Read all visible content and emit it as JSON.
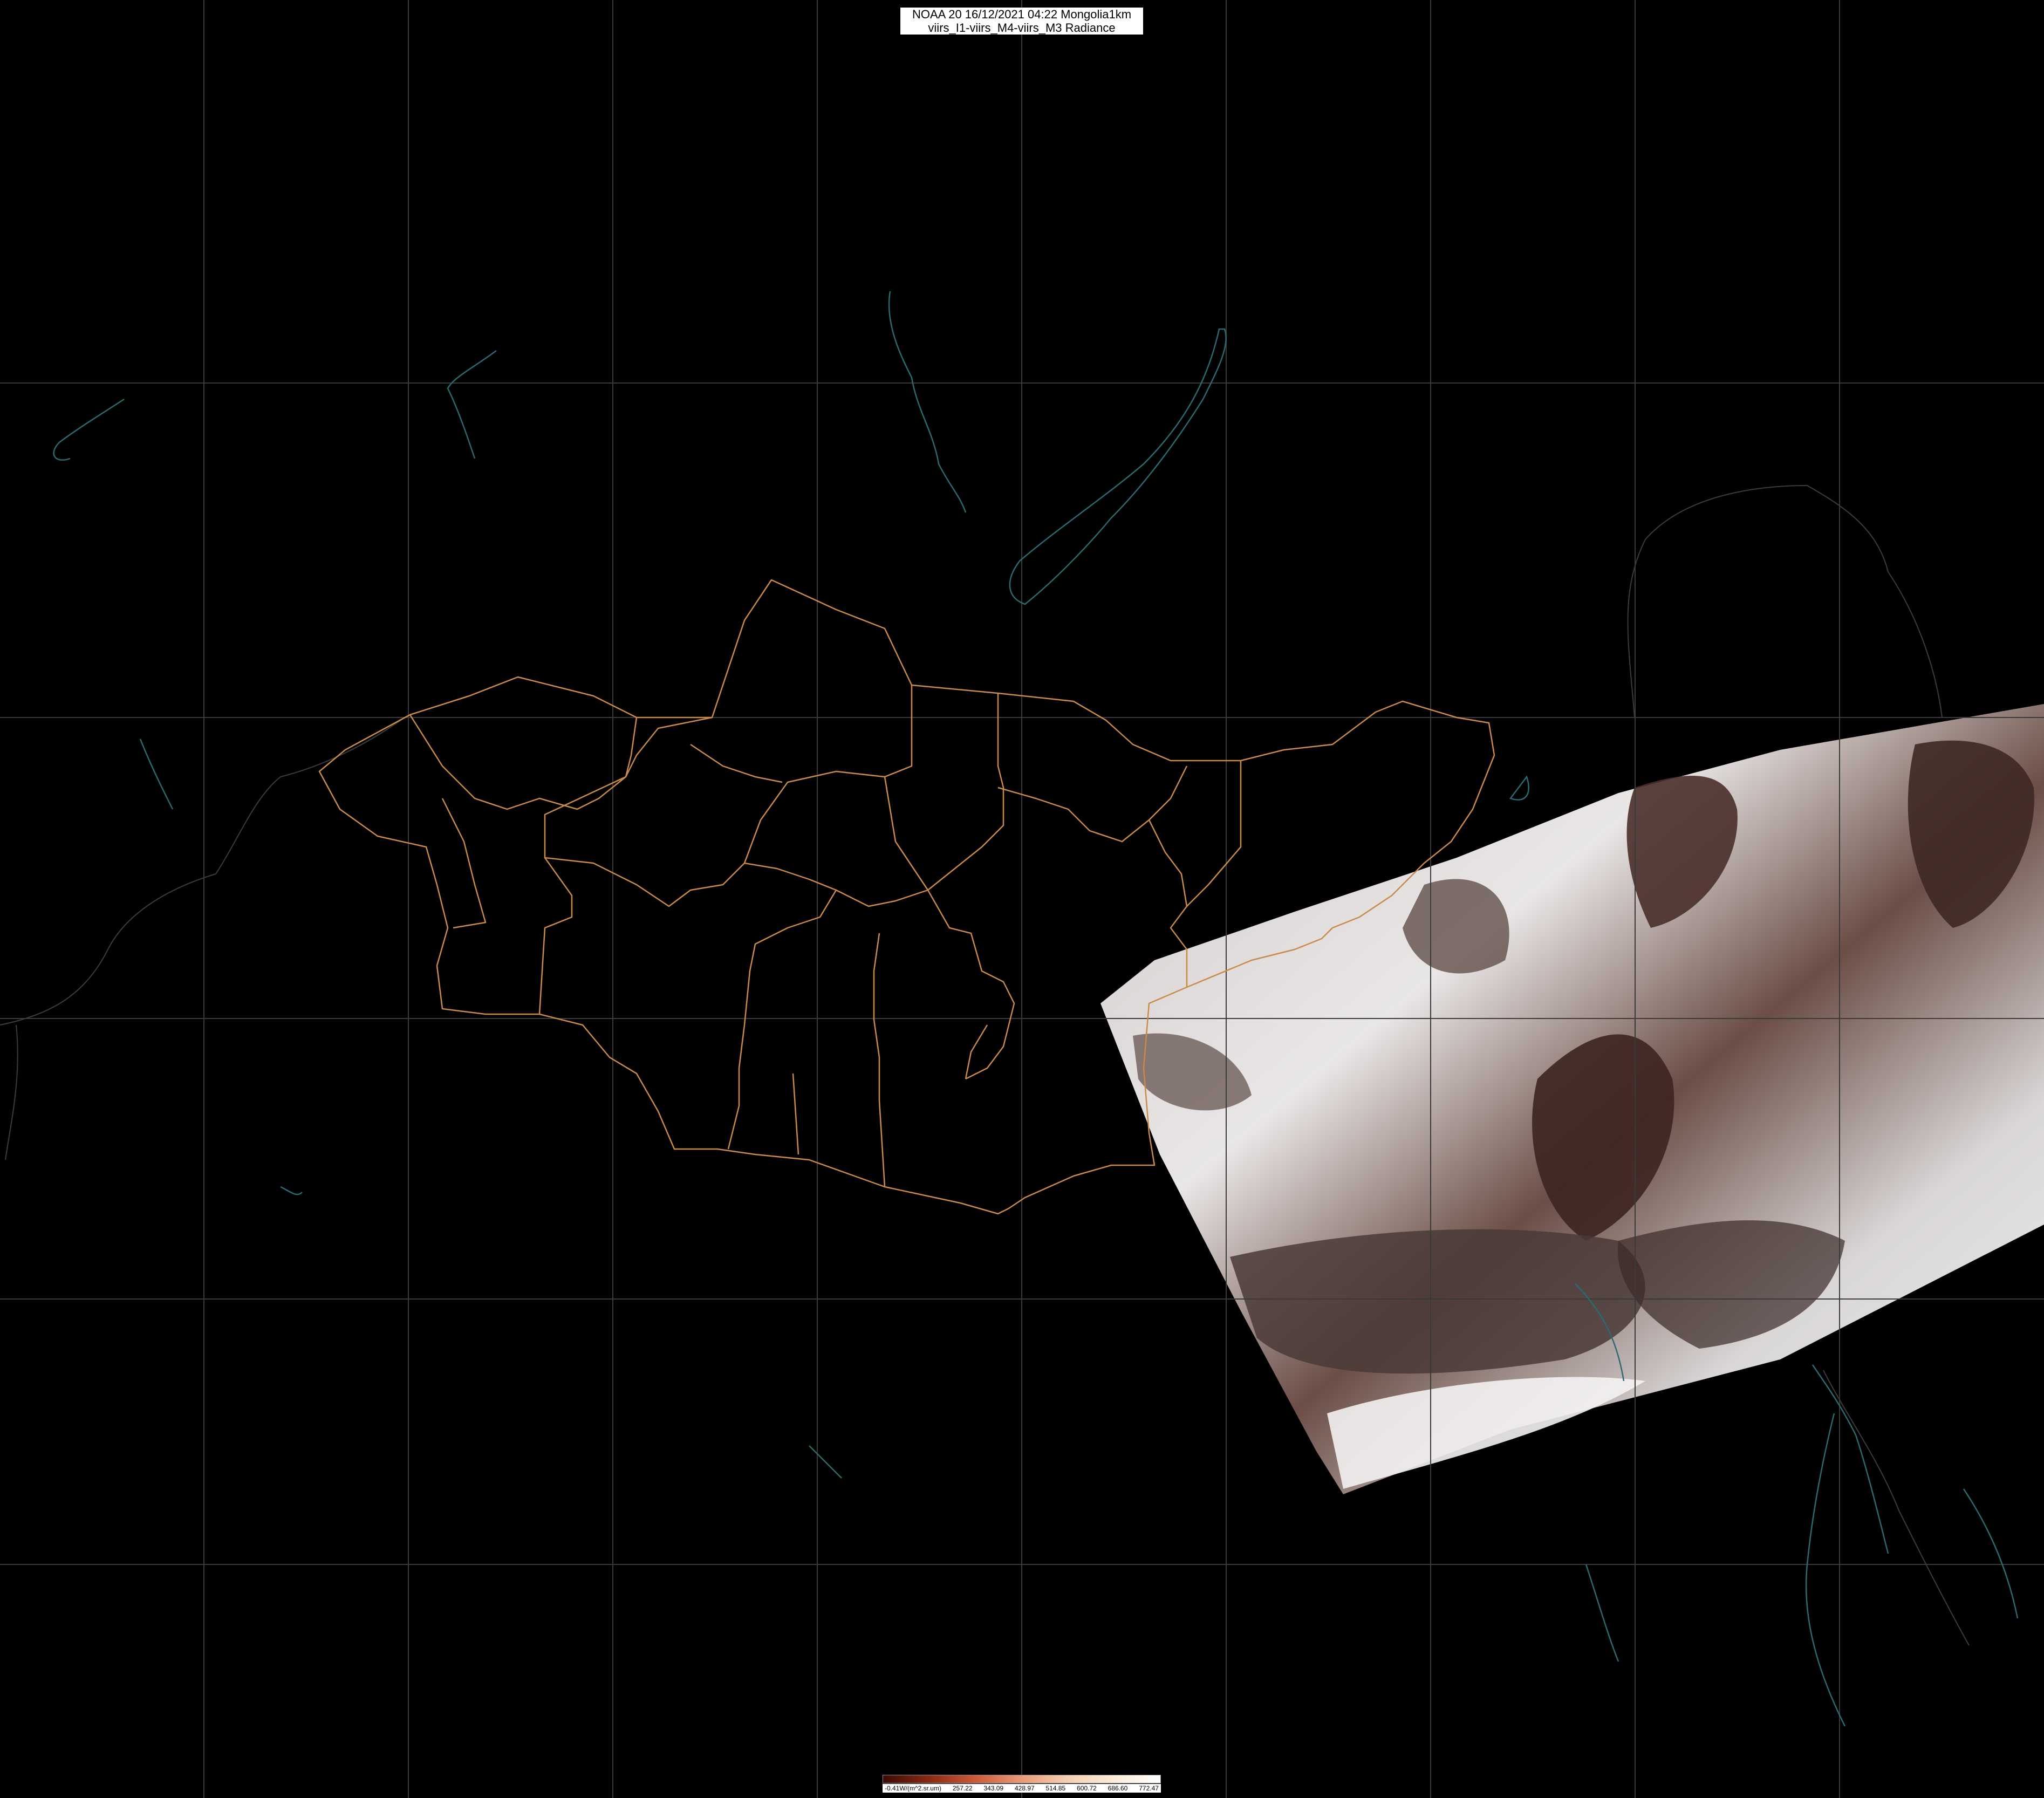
{
  "header": {
    "line1": "NOAA 20 16/12/2021 04:22 Mongolia1km",
    "line2": "viirs_I1-viirs_M4-viirs_M3 Radiance"
  },
  "legend": {
    "labels": [
      "-0.41W/(m^2.sr.um)",
      "257.22",
      "343.09",
      "428.97",
      "514.85",
      "600.72",
      "686.60",
      "772.47"
    ],
    "colors": [
      "#3a0c05",
      "#8a2a14",
      "#cc5a3a",
      "#e89a78",
      "#f4cfb2",
      "#fbecd8",
      "#ffffff"
    ]
  },
  "colors": {
    "background": "#000000",
    "graticule": "#3a3a3a",
    "province_border": "#c98a4a",
    "coastline": "#2a6a70",
    "country_border": "#3c3c3c"
  },
  "icons": [
    "satellite-swath-image",
    "province-border-lines",
    "coastline-lines",
    "graticule-grid"
  ]
}
